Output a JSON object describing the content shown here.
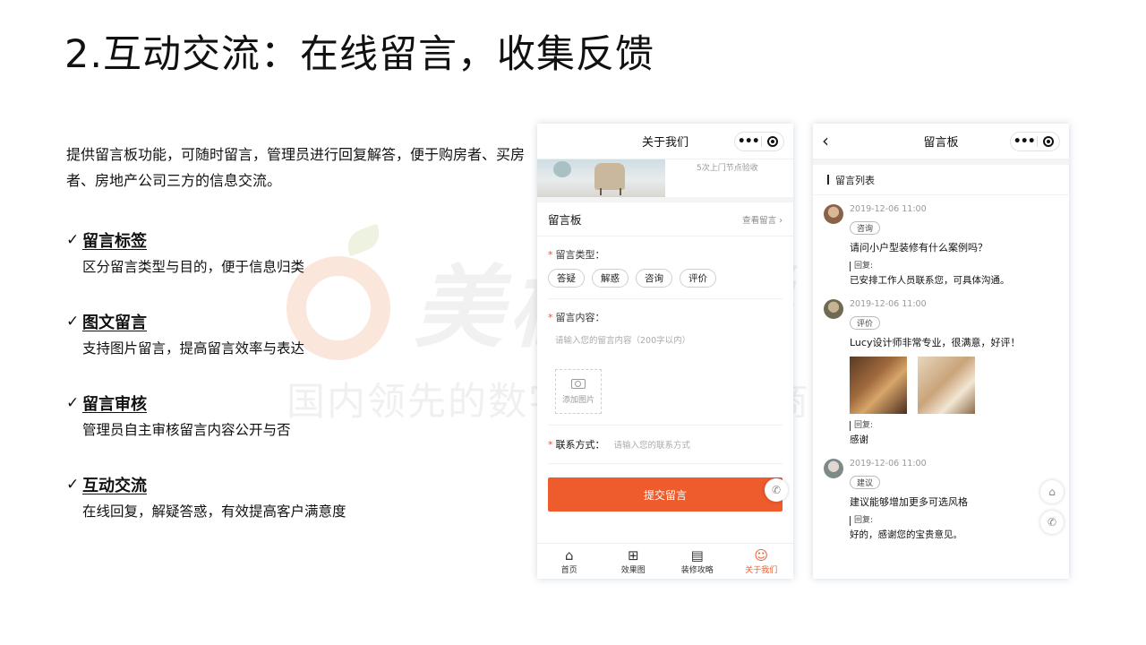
{
  "slide": {
    "title": "2.互动交流：在线留言，收集反馈",
    "intro": "提供留言板功能，可随时留言，管理员进行回复解答，便于购房者、买房者、房地产公司三方的信息交流。"
  },
  "watermark": {
    "brand": "美橙互联",
    "slogan": "国内领先的数字化营销服务商"
  },
  "features": [
    {
      "name": "留言标签",
      "desc": "区分留言类型与目的，便于信息归类"
    },
    {
      "name": "图文留言",
      "desc": "支持图片留言，提高留言效率与表达"
    },
    {
      "name": "留言审核",
      "desc": "管理员自主审核留言内容公开与否"
    },
    {
      "name": "互动交流",
      "desc": "在线回复，解疑答惑，有效提高客户满意度"
    }
  ],
  "phone1": {
    "nav_title": "关于我们",
    "banner_text": "5次上门节点验收",
    "board_title": "留言板",
    "view_link": "查看留言",
    "type_label": "留言类型：",
    "types": [
      "答疑",
      "解惑",
      "咨询",
      "评价"
    ],
    "content_label": "留言内容：",
    "content_placeholder": "请输入您的留言内容（200字以内）",
    "upload_label": "添加图片",
    "contact_label": "联系方式：",
    "contact_placeholder": "请输入您的联系方式",
    "submit_label": "提交留言",
    "tabs": [
      {
        "label": "首页",
        "icon": "home-icon"
      },
      {
        "label": "效果图",
        "icon": "grid-icon"
      },
      {
        "label": "装修攻略",
        "icon": "document-icon"
      },
      {
        "label": "关于我们",
        "icon": "users-icon"
      }
    ],
    "accent": "#ee5b2c"
  },
  "phone2": {
    "nav_title": "留言板",
    "list_title": "留言列表",
    "reply_label": "回复:",
    "messages": [
      {
        "time": "2019-12-06 11:00",
        "tag": "咨询",
        "content": "请问小户型装修有什么案例吗？",
        "reply": "已安排工作人员联系您，可具体沟通。"
      },
      {
        "time": "2019-12-06 11:00",
        "tag": "评价",
        "content": "Lucy设计师非常专业，很满意，好评！",
        "reply": "感谢"
      },
      {
        "time": "2019-12-06 11:00",
        "tag": "建议",
        "content": "建议能够增加更多可选风格",
        "reply": "好的，感谢您的宝贵意见。"
      }
    ]
  }
}
